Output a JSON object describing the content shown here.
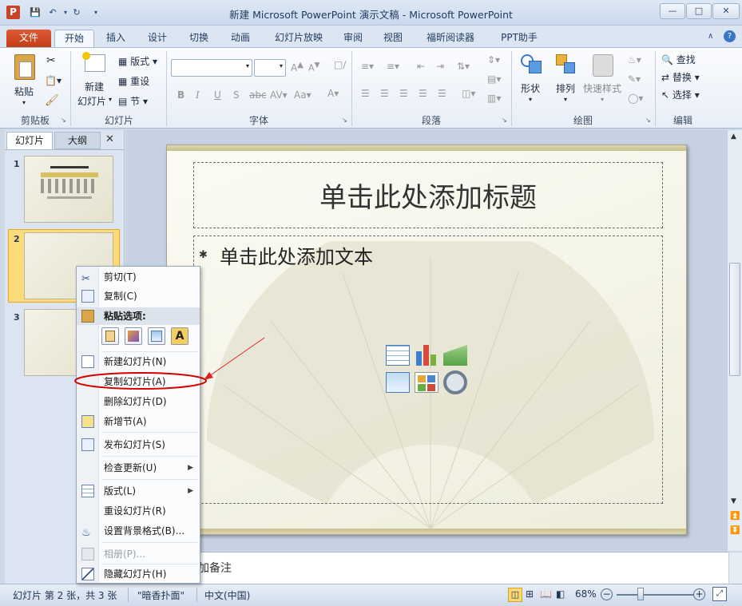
{
  "window": {
    "title": "新建 Microsoft PowerPoint 演示文稿 - Microsoft PowerPoint",
    "app_icon": "P"
  },
  "ribbon_tabs": [
    "文件",
    "开始",
    "插入",
    "设计",
    "切换",
    "动画",
    "幻灯片放映",
    "审阅",
    "视图",
    "福昕阅读器",
    "PPT助手"
  ],
  "groups": {
    "clipboard": {
      "label": "剪贴板",
      "paste": "粘贴"
    },
    "slides": {
      "label": "幻灯片",
      "new_slide": "新建",
      "new_slide2": "幻灯片",
      "layout": "版式",
      "reset": "重设",
      "section": "节"
    },
    "font": {
      "label": "字体",
      "bold": "B",
      "italic": "I",
      "underline": "U",
      "shadow": "S",
      "strike": "abc"
    },
    "paragraph": {
      "label": "段落"
    },
    "drawing": {
      "label": "绘图",
      "shapes": "形状",
      "arrange": "排列",
      "quick_styles": "快速样式"
    },
    "editing": {
      "label": "编辑",
      "find": "查找",
      "replace": "替换",
      "select": "选择"
    }
  },
  "panel": {
    "tab_slides": "幻灯片",
    "tab_outline": "大纲",
    "close": "✕",
    "slide_numbers": [
      "1",
      "2",
      "3"
    ]
  },
  "slide": {
    "title_placeholder": "单击此处添加标题",
    "body_placeholder": "单击此处添加文本"
  },
  "notes": {
    "text": "加备注"
  },
  "context_menu": {
    "cut": "剪切(T)",
    "copy": "复制(C)",
    "paste_options": "粘贴选项:",
    "paste_keep_text": "A",
    "new_slide": "新建幻灯片(N)",
    "duplicate_slide": "复制幻灯片(A)",
    "delete_slide": "删除幻灯片(D)",
    "add_section": "新增节(A)",
    "publish_slides": "发布幻灯片(S)",
    "check_updates": "检查更新(U)",
    "layout": "版式(L)",
    "reset_slide": "重设幻灯片(R)",
    "format_background": "设置背景格式(B)...",
    "photo_album": "相册(P)...",
    "hide_slide": "隐藏幻灯片(H)"
  },
  "status": {
    "slide_info": "幻灯片 第 2 张，共 3 张",
    "theme": "\"暗香扑面\"",
    "language": "中文(中国)",
    "zoom": "68%",
    "zoom_level": 0.68
  },
  "colors": {
    "file_tab": "#d24726",
    "annotation": "#e02020",
    "highlight_ellipse": "#d40000"
  }
}
